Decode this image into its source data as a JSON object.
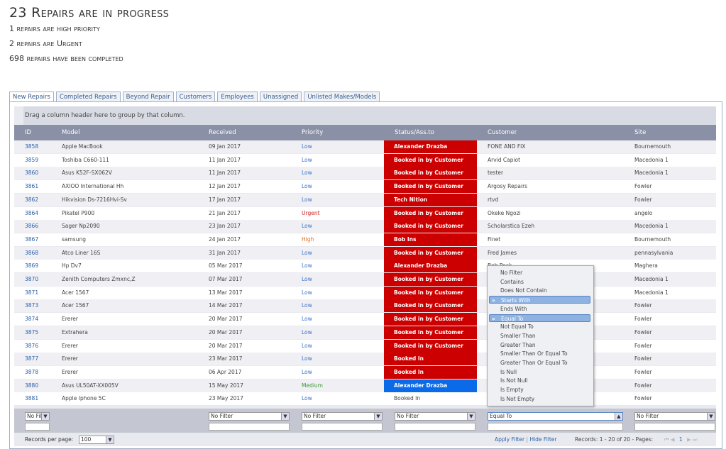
{
  "stats": {
    "in_progress": "23 Repairs are in progress",
    "high_priority": "1 repairs are high priority",
    "urgent": "2 repairs are Urgent",
    "completed": "698 repairs have been completed"
  },
  "tabs": [
    {
      "label": "New Repairs"
    },
    {
      "label": "Completed Repairs"
    },
    {
      "label": "Beyond Repair"
    },
    {
      "label": "Customers"
    },
    {
      "label": "Employees"
    },
    {
      "label": "Unassigned"
    },
    {
      "label": "Unlisted Makes/Models"
    }
  ],
  "grid": {
    "group_hint": "Drag a column header here to group by that column.",
    "columns": [
      "ID",
      "Model",
      "Received",
      "Priority",
      "Status/Ass.to",
      "Customer",
      "Site"
    ],
    "rows": [
      {
        "id": "3858",
        "model": "Apple MacBook",
        "received": "09 Jan 2017",
        "priority": "Low",
        "status": "Alexander Drazba",
        "customer": "FONE AND FIX",
        "site": "Bournemouth"
      },
      {
        "id": "3859",
        "model": "Toshiba C660-111",
        "received": "11 Jan 2017",
        "priority": "Low",
        "status": "Booked in by Customer",
        "customer": "Arvid Capiot",
        "site": "Macedonia 1"
      },
      {
        "id": "3860",
        "model": "Asus K52F-SX062V",
        "received": "11 Jan 2017",
        "priority": "Low",
        "status": "Booked in by Customer",
        "customer": "tester",
        "site": "Macedonia 1"
      },
      {
        "id": "3861",
        "model": "AXIOO International Hh",
        "received": "12 Jan 2017",
        "priority": "Low",
        "status": "Booked in by Customer",
        "customer": "Argosy Repairs",
        "site": "Fowler"
      },
      {
        "id": "3862",
        "model": "Hikvision Ds-7216Hvi-Sv",
        "received": "17 Jan 2017",
        "priority": "Low",
        "status": "Tech Nition",
        "customer": "rtvd",
        "site": "Fowler"
      },
      {
        "id": "3864",
        "model": "Pikatel P900",
        "received": "21 Jan 2017",
        "priority": "Urgent",
        "status": "Booked in by Customer",
        "customer": "Okeke Ngozi",
        "site": "angelo"
      },
      {
        "id": "3866",
        "model": "Sager Np2090",
        "received": "23 Jan 2017",
        "priority": "Low",
        "status": "Booked in by Customer",
        "customer": "Scholarstica Ezeh",
        "site": "Macedonia 1"
      },
      {
        "id": "3867",
        "model": "samsung",
        "received": "24 Jan 2017",
        "priority": "High",
        "status": "Bob Ins",
        "customer": "Finet",
        "site": "Bournemouth"
      },
      {
        "id": "3868",
        "model": "Atco Liner 16S",
        "received": "31 Jan 2017",
        "priority": "Low",
        "status": "Booked in by Customer",
        "customer": "Fred James",
        "site": "pennasylvania"
      },
      {
        "id": "3869",
        "model": "Hp Dv7",
        "received": "05 Mar 2017",
        "priority": "Low",
        "status": "Alexander Drazba",
        "customer": "Bob Peck",
        "site": "Maghera"
      },
      {
        "id": "3870",
        "model": "Zenith Computers Zmxnc,Z",
        "received": "07 Mar 2017",
        "priority": "Low",
        "status": "Booked in by Customer",
        "customer": "",
        "site": "Macedonia 1"
      },
      {
        "id": "3871",
        "model": "Acer 1567",
        "received": "13 Mar 2017",
        "priority": "Low",
        "status": "Booked in by Customer",
        "customer": "",
        "site": "Macedonia 1"
      },
      {
        "id": "3873",
        "model": "Acer 1567",
        "received": "14 Mar 2017",
        "priority": "Low",
        "status": "Booked in by Customer",
        "customer": "",
        "site": "Fowler"
      },
      {
        "id": "3874",
        "model": "Ererer",
        "received": "20 Mar 2017",
        "priority": "Low",
        "status": "Booked in by Customer",
        "customer": "",
        "site": "Fowler"
      },
      {
        "id": "3875",
        "model": "Extrahera",
        "received": "20 Mar 2017",
        "priority": "Low",
        "status": "Booked in by Customer",
        "customer": "",
        "site": "Fowler"
      },
      {
        "id": "3876",
        "model": "Ererer",
        "received": "20 Mar 2017",
        "priority": "Low",
        "status": "Booked in by Customer",
        "customer": "",
        "site": "Fowler"
      },
      {
        "id": "3877",
        "model": "Ererer",
        "received": "23 Mar 2017",
        "priority": "Low",
        "status": "Booked In",
        "customer": "",
        "site": "Fowler"
      },
      {
        "id": "3878",
        "model": "Ererer",
        "received": "06 Apr 2017",
        "priority": "Low",
        "status": "Booked In",
        "customer": "",
        "site": "Fowler"
      },
      {
        "id": "3880",
        "model": "Asus UL50AT-XX005V",
        "received": "15 May 2017",
        "priority": "Medium",
        "status": "Alexander Drazba",
        "customer": "",
        "site": "Fowler"
      },
      {
        "id": "3881",
        "model": "Apple Iphone 5C",
        "received": "23 May 2017",
        "priority": "Low",
        "status": "Booked In",
        "customer": "",
        "site": "Fowler"
      }
    ],
    "row_status_style": [
      "red",
      "red",
      "red",
      "red",
      "red",
      "red",
      "red",
      "red",
      "red",
      "red",
      "red",
      "red",
      "red",
      "red",
      "red",
      "red",
      "red",
      "red",
      "blue",
      "none"
    ],
    "filters": {
      "id": "No Fil",
      "received": "No Filter",
      "priority": "No Filter",
      "status": "No Filter",
      "customer": "Equal To",
      "site": "No Filter"
    },
    "footer": {
      "records_per_page_label": "Records per page:",
      "records_per_page_value": "100",
      "apply_filter": "Apply Filter",
      "separator": "|",
      "hide_filter": "Hide Filter",
      "records_info": "Records: 1 - 20 of 20 - Pages:",
      "current_page": "1"
    }
  },
  "filter_dropdown": {
    "options": [
      "No Filter",
      "Contains",
      "Does Not Contain",
      "Starts With",
      "Ends With",
      "Equal To",
      "Not Equal To",
      "Smaller Than",
      "Greater Than",
      "Smaller Than Or Equal To",
      "Greater Than Or Equal To",
      "Is Null",
      "Is Not Null",
      "Is Empty",
      "Is Not Empty"
    ],
    "selected": [
      "Starts With",
      "Equal To"
    ],
    "selected_marker": "»"
  },
  "colors": {
    "status_red": "#cc0000",
    "status_blue": "#0a6ae8",
    "header_bg": "#8a90a5",
    "link": "#2a5fa8"
  }
}
